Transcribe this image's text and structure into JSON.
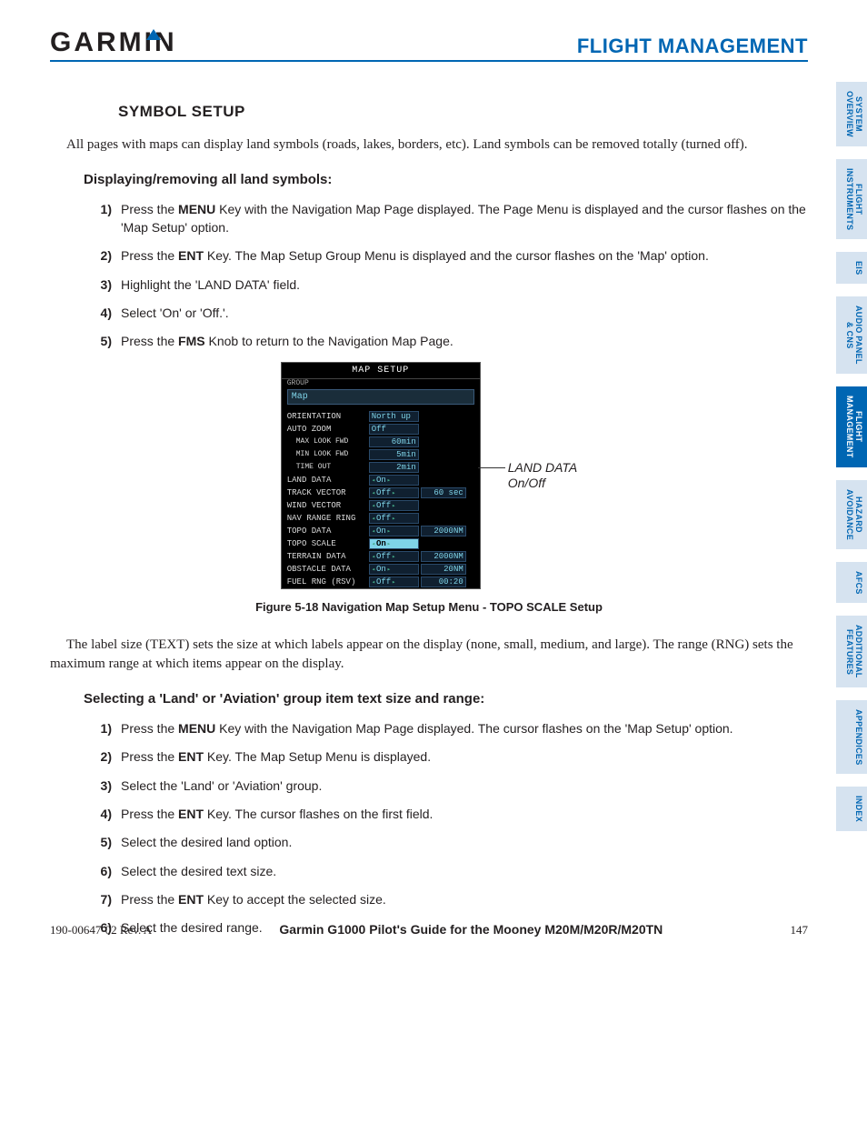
{
  "header": {
    "logo_text": "GARMIN",
    "title": "FLIGHT MANAGEMENT"
  },
  "section_heading": "SYMBOL SETUP",
  "intro_para": "All pages with maps can display land symbols (roads, lakes, borders, etc).  Land symbols can be removed totally (turned off).",
  "sub1_heading": "Displaying/removing all land symbols:",
  "steps1": [
    {
      "n": "1)",
      "pre": "Press the ",
      "b": "MENU",
      "post": " Key with the Navigation Map Page displayed.  The Page Menu is displayed and the cursor flashes on the 'Map Setup' option."
    },
    {
      "n": "2)",
      "pre": "Press the ",
      "b": "ENT",
      "post": " Key.  The Map Setup Group Menu is displayed and the cursor flashes on the 'Map' option."
    },
    {
      "n": "3)",
      "pre": "Highlight the 'LAND DATA' field.",
      "b": "",
      "post": ""
    },
    {
      "n": "4)",
      "pre": "Select 'On' or 'Off.'.",
      "b": "",
      "post": ""
    },
    {
      "n": "5)",
      "pre": "Press the ",
      "b": "FMS",
      "post": " Knob to return to the Navigation Map Page."
    }
  ],
  "map_setup": {
    "title": "MAP SETUP",
    "group_label": "GROUP",
    "group_value": "Map",
    "rows": [
      {
        "label": "ORIENTATION",
        "v1": "North up",
        "v2": "",
        "sub": false,
        "arrows": false,
        "right": false
      },
      {
        "label": "AUTO ZOOM",
        "v1": "Off",
        "v2": "",
        "sub": false,
        "arrows": false,
        "right": false
      },
      {
        "label": "MAX LOOK FWD",
        "v1": "60min",
        "v2": "",
        "sub": true,
        "arrows": false,
        "right": true
      },
      {
        "label": "MIN LOOK FWD",
        "v1": "5min",
        "v2": "",
        "sub": true,
        "arrows": false,
        "right": true
      },
      {
        "label": "TIME OUT",
        "v1": "2min",
        "v2": "",
        "sub": true,
        "arrows": false,
        "right": true
      },
      {
        "label": "LAND DATA",
        "v1": "On",
        "v2": "",
        "sub": false,
        "arrows": true,
        "right": false
      },
      {
        "label": "TRACK VECTOR",
        "v1": "Off",
        "v2": "60 sec",
        "sub": false,
        "arrows": true,
        "right": false
      },
      {
        "label": "WIND VECTOR",
        "v1": "Off",
        "v2": "",
        "sub": false,
        "arrows": true,
        "right": false
      },
      {
        "label": "NAV RANGE RING",
        "v1": "Off",
        "v2": "",
        "sub": false,
        "arrows": true,
        "right": false
      },
      {
        "label": "TOPO DATA",
        "v1": "On",
        "v2": "2000NM",
        "sub": false,
        "arrows": true,
        "right": false
      },
      {
        "label": "TOPO SCALE",
        "v1": "On",
        "v2": "",
        "sub": false,
        "arrows": true,
        "right": false,
        "selected": true
      },
      {
        "label": "TERRAIN DATA",
        "v1": "Off",
        "v2": "2000NM",
        "sub": false,
        "arrows": true,
        "right": false
      },
      {
        "label": "OBSTACLE DATA",
        "v1": "On",
        "v2": "20NM",
        "sub": false,
        "arrows": true,
        "right": false
      },
      {
        "label": "FUEL RNG (RSV)",
        "v1": "Off",
        "v2": "00:20",
        "sub": false,
        "arrows": true,
        "right": false
      }
    ]
  },
  "callout": "LAND DATA\nOn/Off",
  "figure_caption": "Figure 5-18  Navigation Map Setup Menu - TOPO SCALE Setup",
  "para2": "The label size (TEXT) sets the size at which labels appear on the display (none, small, medium, and large).  The range (RNG) sets the maximum range at which items appear on the display.",
  "sub2_heading": "Selecting a 'Land' or 'Aviation' group item text size and range:",
  "steps2": [
    {
      "n": "1)",
      "pre": "Press the ",
      "b": "MENU",
      "post": " Key with the Navigation Map Page displayed.  The cursor flashes on the 'Map Setup' option."
    },
    {
      "n": "2)",
      "pre": "Press the ",
      "b": "ENT",
      "post": " Key.  The Map Setup Menu is displayed."
    },
    {
      "n": "3)",
      "pre": "Select the 'Land'  or 'Aviation' group.",
      "b": "",
      "post": ""
    },
    {
      "n": "4)",
      "pre": "Press the ",
      "b": "ENT",
      "post": " Key.  The cursor flashes on the first field."
    },
    {
      "n": "5)",
      "pre": "Select the desired land option.",
      "b": "",
      "post": ""
    },
    {
      "n": "6)",
      "pre": "Select the desired text size.",
      "b": "",
      "post": ""
    },
    {
      "n": "7)",
      "pre": "Press the ",
      "b": "ENT",
      "post": " Key to accept the selected size."
    },
    {
      "n": "6)",
      "pre": "Select the desired range.",
      "b": "",
      "post": ""
    }
  ],
  "footer": {
    "left": "190-00647-02  Rev. A",
    "center": "Garmin G1000 Pilot's Guide for the Mooney M20M/M20R/M20TN",
    "right": "147"
  },
  "tabs": [
    {
      "label": "SYSTEM\nOVERVIEW",
      "active": false
    },
    {
      "label": "FLIGHT\nINSTRUMENTS",
      "active": false
    },
    {
      "label": "EIS",
      "active": false
    },
    {
      "label": "AUDIO PANEL\n& CNS",
      "active": false
    },
    {
      "label": "FLIGHT\nMANAGEMENT",
      "active": true
    },
    {
      "label": "HAZARD\nAVOIDANCE",
      "active": false
    },
    {
      "label": "AFCS",
      "active": false
    },
    {
      "label": "ADDITIONAL\nFEATURES",
      "active": false
    },
    {
      "label": "APPENDICES",
      "active": false
    },
    {
      "label": "INDEX",
      "active": false
    }
  ]
}
